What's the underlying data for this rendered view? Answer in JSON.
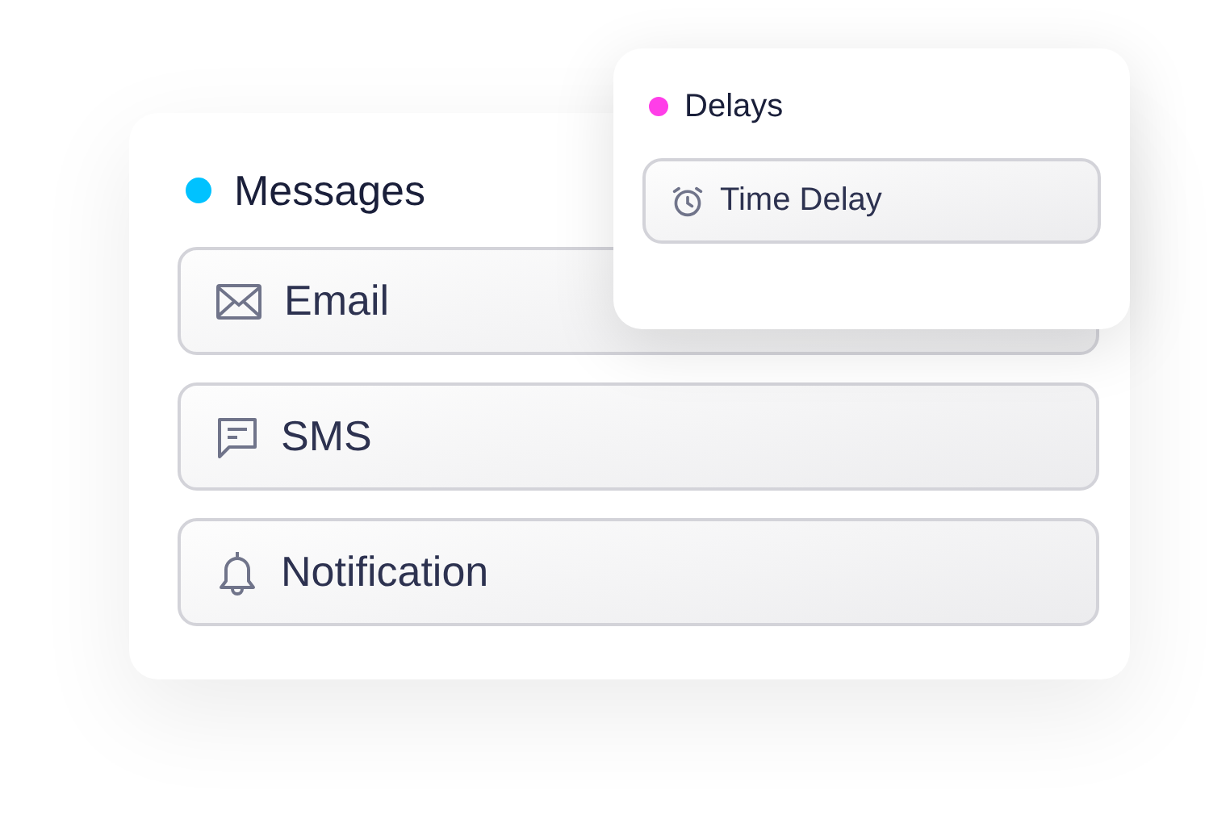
{
  "messages": {
    "title": "Messages",
    "color": "#00c2ff",
    "items": [
      {
        "kind": "email",
        "label": "Email"
      },
      {
        "kind": "sms",
        "label": "SMS"
      },
      {
        "kind": "notification",
        "label": "Notification"
      }
    ]
  },
  "delays": {
    "title": "Delays",
    "color": "#ff3ee8",
    "items": [
      {
        "kind": "clock",
        "label": "Time Delay"
      }
    ]
  }
}
